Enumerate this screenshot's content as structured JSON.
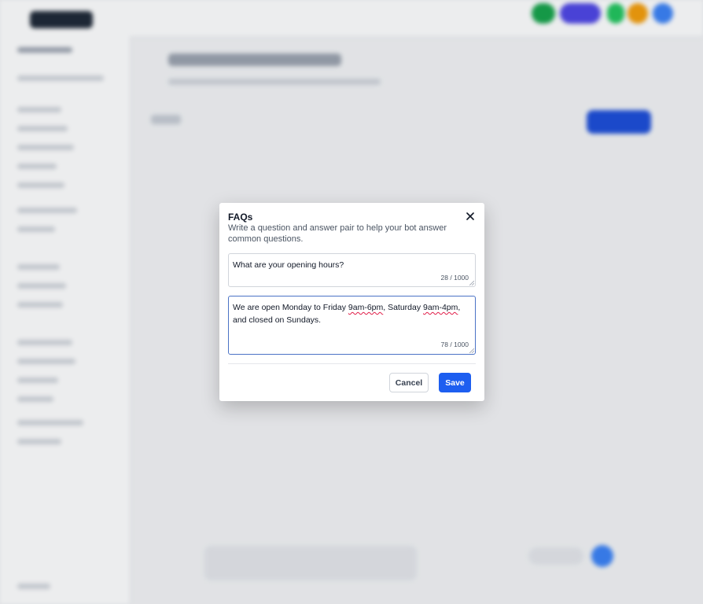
{
  "modal": {
    "title": "FAQs",
    "description": "Write a question and answer pair to help your bot answer common questions.",
    "close_icon": "close-icon",
    "question": {
      "value": "What are your opening hours?",
      "counter": "28 / 1000"
    },
    "answer": {
      "value": "We are open Monday to Friday 9am-6pm, Saturday 9am-4pm, and closed on Sundays.",
      "counter": "78 / 1000",
      "segments": {
        "s1": "We are open Monday to Friday ",
        "s2": "9am-6pm",
        "s3": ", Saturday ",
        "s4": "9am-4pm",
        "s5": ", and closed on Sundays."
      }
    },
    "cancel_label": "Cancel",
    "save_label": "Save"
  },
  "colors": {
    "primary": "#1d5ef0",
    "focus_border": "#4b73c6",
    "spellcheck": "#e11d48"
  }
}
